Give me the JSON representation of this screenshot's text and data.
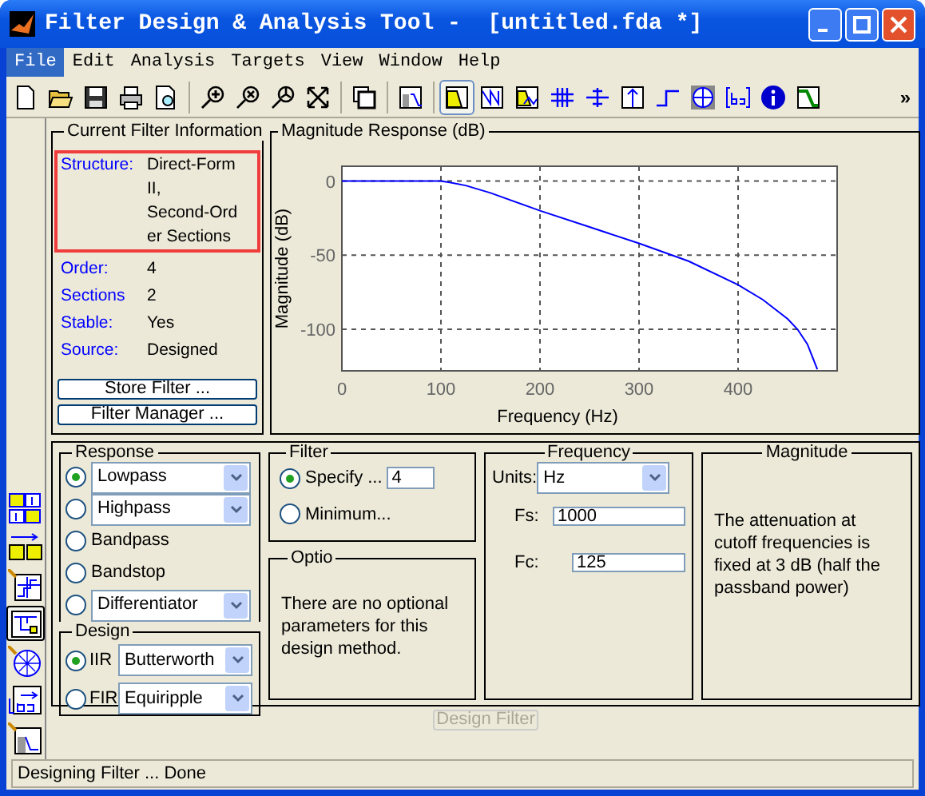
{
  "window": {
    "title": "Filter Design & Analysis Tool -  [untitled.fda *]"
  },
  "menu": [
    {
      "label": "File",
      "selected": true
    },
    {
      "label": "Edit",
      "selected": false
    },
    {
      "label": "Analysis",
      "selected": false
    },
    {
      "label": "Targets",
      "selected": false
    },
    {
      "label": "View",
      "selected": false
    },
    {
      "label": "Window",
      "selected": false
    },
    {
      "label": "Help",
      "selected": false
    }
  ],
  "toolbar": {
    "file_tools": [
      {
        "kind": "new"
      },
      {
        "kind": "open"
      },
      {
        "kind": "save"
      },
      {
        "kind": "print"
      },
      {
        "kind": "preview"
      }
    ],
    "zoom_tools": [
      {
        "kind": "zoomin"
      },
      {
        "kind": "zoomout"
      },
      {
        "kind": "zoomxy"
      },
      {
        "kind": "fullview"
      }
    ],
    "window_tools": [
      {
        "kind": "newwin"
      },
      {
        "kind": "designmode"
      }
    ],
    "analysis_tools": [
      {
        "kind": "magnitude",
        "selected": true
      },
      {
        "kind": "phase",
        "selected": false
      },
      {
        "kind": "magphase",
        "selected": false
      },
      {
        "kind": "groupdelay",
        "selected": false
      },
      {
        "kind": "phasedelay",
        "selected": false
      },
      {
        "kind": "impulse",
        "selected": false
      },
      {
        "kind": "step",
        "selected": false
      },
      {
        "kind": "polezero",
        "selected": false
      },
      {
        "kind": "coeffs",
        "selected": false
      },
      {
        "kind": "info",
        "selected": false
      },
      {
        "kind": "magestimate",
        "selected": false
      }
    ],
    "overflow": "»"
  },
  "side_tools": [
    {
      "kind": "convert",
      "selected": false
    },
    {
      "kind": "multirate",
      "selected": false
    },
    {
      "kind": "quantize",
      "selected": false
    },
    {
      "kind": "realize",
      "selected": true
    },
    {
      "kind": "polezero",
      "selected": false
    },
    {
      "kind": "import",
      "selected": false
    },
    {
      "kind": "design",
      "selected": false
    }
  ],
  "filter_info": {
    "title": "Current Filter Information",
    "fields": [
      {
        "label": "Structure:",
        "value_lines": [
          "Direct-Form",
          "II,",
          "Second-Ord",
          "er Sections"
        ],
        "highlighted": true
      },
      {
        "label": "Order:",
        "value_lines": [
          "4"
        ],
        "highlighted": false
      },
      {
        "label": "Sections",
        "value_lines": [
          "2"
        ],
        "highlighted": false
      },
      {
        "label": "Stable:",
        "value_lines": [
          "Yes"
        ],
        "highlighted": false
      },
      {
        "label": "Source:",
        "value_lines": [
          "Designed"
        ],
        "highlighted": false
      }
    ],
    "buttons": [
      "Store Filter ...",
      "Filter Manager ..."
    ]
  },
  "magnitude_response": {
    "title": "Magnitude Response (dB)",
    "chart_data": {
      "type": "line",
      "xlabel": "Frequency (Hz)",
      "ylabel": "Magnitude (dB)",
      "x": [
        0,
        50,
        100,
        110,
        125,
        150,
        200,
        250,
        300,
        350,
        400,
        425,
        450,
        460,
        470,
        480
      ],
      "grid": true,
      "series": [
        {
          "color": "#0000ff",
          "values": [
            0,
            0,
            0,
            -1,
            -3,
            -8,
            -20,
            -31,
            -42,
            -54,
            -70,
            -80,
            -93,
            -100,
            -110,
            -127
          ]
        }
      ],
      "xlim": [
        0,
        500
      ],
      "ylim": [
        -128,
        10
      ],
      "xticks": [
        0,
        100,
        200,
        300,
        400
      ],
      "yticks": [
        0,
        -50,
        -100
      ]
    }
  },
  "response": {
    "title": "Response",
    "options": [
      {
        "label": "Lowpass",
        "kind": "dropdown",
        "selected": true
      },
      {
        "label": "Highpass",
        "kind": "dropdown",
        "selected": false
      },
      {
        "label": "Bandpass",
        "kind": "plain",
        "selected": false
      },
      {
        "label": "Bandstop",
        "kind": "plain",
        "selected": false
      },
      {
        "label": "Differentiator",
        "kind": "dropdown",
        "selected": false
      }
    ]
  },
  "design": {
    "title": "Design",
    "options": [
      {
        "label": "IIR",
        "method": "Butterworth",
        "selected": true
      },
      {
        "label": "FIR",
        "method": "Equiripple",
        "selected": false
      }
    ]
  },
  "filter_order": {
    "title": "Filter",
    "options": [
      {
        "label": "Specify ...",
        "value": "4",
        "selected": true
      },
      {
        "label": "Minimum...",
        "selected": false
      }
    ]
  },
  "options": {
    "title": "Optio",
    "text": "There are no optional parameters for this design method."
  },
  "frequency": {
    "title": "Frequency",
    "units_label": "Units:",
    "units": "Hz",
    "fields": [
      {
        "label": "Fs:",
        "value": "1000"
      },
      {
        "label": "Fc:",
        "value": "125"
      }
    ]
  },
  "magnitude": {
    "title": "Magnitude",
    "text": "The attenuation at cutoff frequencies is fixed at 3 dB (half the passband power)"
  },
  "design_button": {
    "label": "Design Filter",
    "disabled": true
  },
  "status_bar": "Designing Filter ... Done"
}
